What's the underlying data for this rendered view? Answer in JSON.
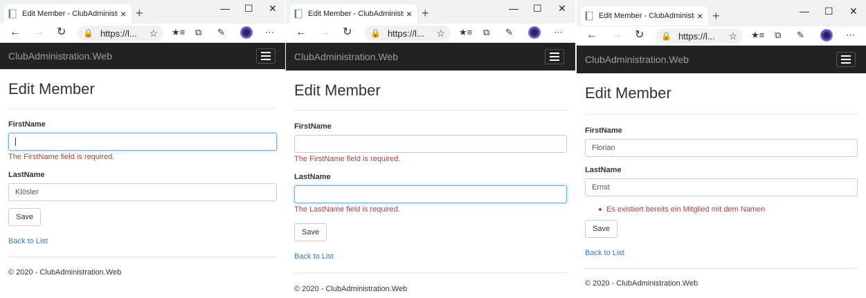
{
  "browser": {
    "tab_title": "Edit Member - ClubAdministratio",
    "url": "https://l...",
    "new_tab_symbol": "+",
    "close_symbol": "×"
  },
  "app": {
    "brand": "ClubAdministration.Web",
    "page_title": "Edit Member",
    "firstname_label": "FirstName",
    "lastname_label": "LastName",
    "save_label": "Save",
    "back_label": "Back to List",
    "footer": "© 2020 - ClubAdministration.Web"
  },
  "panels": [
    {
      "firstname_value": "",
      "lastname_value": "Klösler",
      "firstname_error": "The FirstName field is required.",
      "lastname_error": "",
      "summary": ""
    },
    {
      "firstname_value": "",
      "lastname_value": "",
      "firstname_error": "The FirstName field is required.",
      "lastname_error": "The LastName field is required.",
      "summary": ""
    },
    {
      "firstname_value": "Florian",
      "lastname_value": "Ernst",
      "firstname_error": "",
      "lastname_error": "",
      "summary": "Es existiert bereits ein Mitglied mit dem Namen"
    }
  ],
  "colors": {
    "navbar": "#222222",
    "error": "#a94442",
    "link": "#337ab7",
    "focus": "#66afe9"
  }
}
